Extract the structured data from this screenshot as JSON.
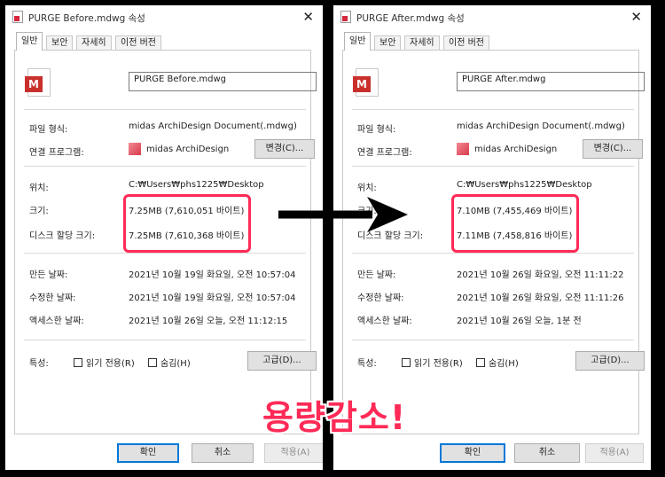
{
  "colors": {
    "highlight": "#ff2a56",
    "window_bg": "#ffffff",
    "background": "#000000"
  },
  "left": {
    "title": "PURGE Before.mdwg 속성",
    "tabs": [
      "일반",
      "보안",
      "자세히",
      "이전 버전"
    ],
    "file_name": "PURGE Before.mdwg",
    "file_type_label": "파일 형식:",
    "file_type_value": "midas ArchiDesign Document(.mdwg)",
    "open_with_label": "연결 프로그램:",
    "open_with_value": "midas ArchiDesign",
    "change_button": "변경(C)...",
    "location_label": "위치:",
    "location_value": "C:₩Users₩phs1225₩Desktop",
    "size_label": "크기:",
    "size_value": "7.25MB (7,610,051 바이트)",
    "size_on_disk_label": "디스크 할당 크기:",
    "size_on_disk_value": "7.25MB (7,610,368 바이트)",
    "created_label": "만든 날짜:",
    "created_value": "2021년 10월 19일 화요일, 오전 10:57:04",
    "modified_label": "수정한 날짜:",
    "modified_value": "2021년 10월 19일 화요일, 오전 10:57:04",
    "accessed_label": "액세스한 날짜:",
    "accessed_value": "2021년 10월 26일 오늘, 오전 11:12:15",
    "attributes_label": "특성:",
    "readonly_label": "읽기 전용(R)",
    "hidden_label": "숨김(H)",
    "advanced_button": "고급(D)...",
    "ok_button": "확인",
    "cancel_button": "취소",
    "apply_button": "적용(A)"
  },
  "right": {
    "title": "PURGE After.mdwg 속성",
    "tabs": [
      "일반",
      "보안",
      "자세히",
      "이전 버전"
    ],
    "file_name": "PURGE After.mdwg",
    "file_type_label": "파일 형식:",
    "file_type_value": "midas ArchiDesign Document(.mdwg)",
    "open_with_label": "연결 프로그램:",
    "open_with_value": "midas ArchiDesign",
    "change_button": "변경(C)...",
    "location_label": "위치:",
    "location_value": "C:₩Users₩phs1225₩Desktop",
    "size_label": "크기:",
    "size_value": "7.10MB (7,455,469 바이트)",
    "size_on_disk_label": "디스크 할당 크기:",
    "size_on_disk_value": "7.11MB (7,458,816 바이트)",
    "created_label": "만든 날짜:",
    "created_value": "2021년 10월 26일 화요일, 오전 11:11:22",
    "modified_label": "수정한 날짜:",
    "modified_value": "2021년 10월 26일 화요일, 오전 11:11:26",
    "accessed_label": "액세스한 날짜:",
    "accessed_value": "2021년 10월 26일 오늘, 1분 전",
    "attributes_label": "특성:",
    "readonly_label": "읽기 전용(R)",
    "hidden_label": "숨김(H)",
    "advanced_button": "고급(D)...",
    "ok_button": "확인",
    "cancel_button": "취소",
    "apply_button": "적용(A)"
  },
  "file_icon_letter": "M",
  "caption": "용량감소!"
}
